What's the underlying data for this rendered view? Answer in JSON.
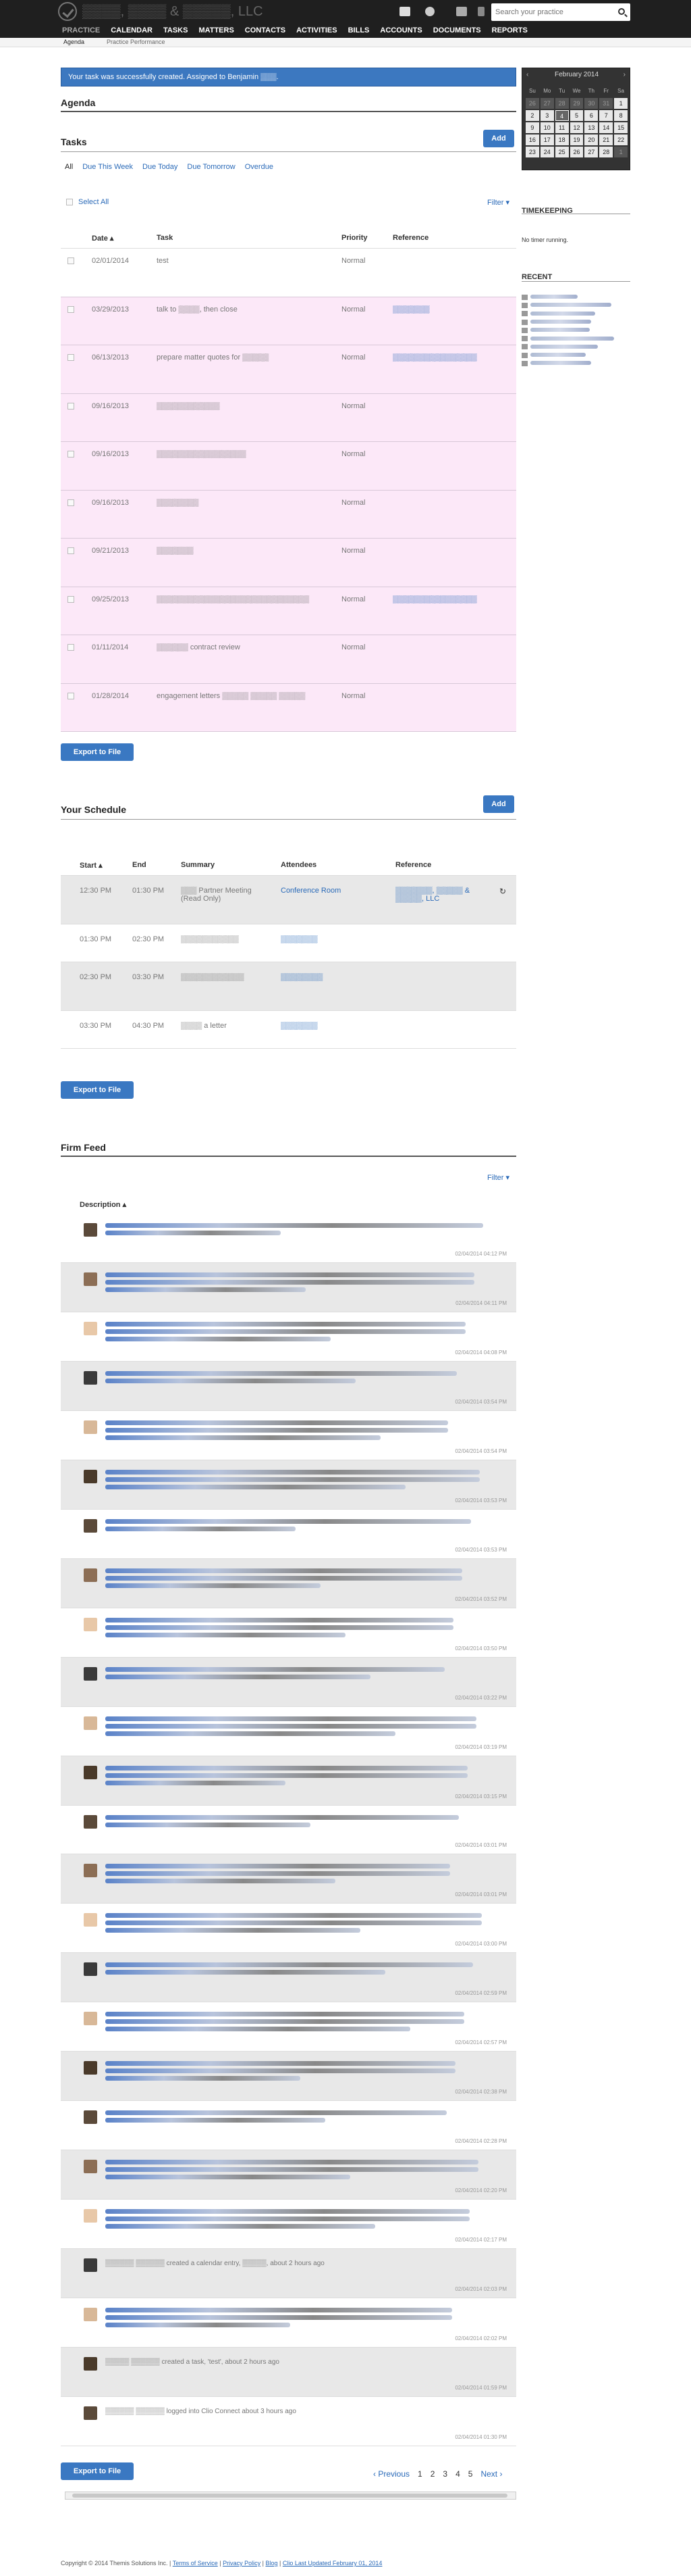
{
  "header": {
    "firm_name": "▒▒▒▒, ▒▒▒▒ & ▒▒▒▒▒, LLC",
    "search_placeholder": "Search your practice",
    "nav": [
      "PRACTICE",
      "CALENDAR",
      "TASKS",
      "MATTERS",
      "CONTACTS",
      "ACTIVITIES",
      "BILLS",
      "ACCOUNTS",
      "DOCUMENTS",
      "REPORTS"
    ],
    "subnav": [
      "Agenda",
      "Practice Performance"
    ]
  },
  "alert": {
    "message": "Your task was successfully created. Assigned to Benjamin ▒▒▒."
  },
  "agenda": {
    "title": "Agenda"
  },
  "tasks": {
    "title": "Tasks",
    "add_label": "Add",
    "tabs": [
      "All",
      "Due This Week",
      "Due Today",
      "Due Tomorrow",
      "Overdue"
    ],
    "select_all": "Select All",
    "filter": "Filter ▾",
    "columns": [
      "Date ▴",
      "Task",
      "Priority",
      "Reference"
    ],
    "rows": [
      {
        "date": "02/01/2014",
        "task": "test",
        "priority": "Normal",
        "ref": ""
      },
      {
        "date": "03/29/2013",
        "task": "talk to ▒▒▒▒, then close",
        "priority": "Normal",
        "ref": "▒▒▒▒▒▒▒"
      },
      {
        "date": "06/13/2013",
        "task": "prepare matter quotes for ▒▒▒▒▒",
        "priority": "Normal",
        "ref": "▒▒▒▒▒▒▒▒▒▒▒▒▒▒▒▒"
      },
      {
        "date": "09/16/2013",
        "task": "▒▒▒▒▒▒▒▒▒▒▒▒",
        "priority": "Normal",
        "ref": ""
      },
      {
        "date": "09/16/2013",
        "task": "▒▒▒▒▒▒▒▒▒▒▒▒▒▒▒▒▒",
        "priority": "Normal",
        "ref": ""
      },
      {
        "date": "09/16/2013",
        "task": "▒▒▒▒▒▒▒▒",
        "priority": "Normal",
        "ref": ""
      },
      {
        "date": "09/21/2013",
        "task": "▒▒▒▒▒▒▒",
        "priority": "Normal",
        "ref": ""
      },
      {
        "date": "09/25/2013",
        "task": "▒▒▒▒▒▒▒▒▒▒▒▒▒▒▒▒▒▒▒▒▒▒▒▒▒▒▒▒▒",
        "priority": "Normal",
        "ref": "▒▒▒▒▒▒▒▒▒▒▒▒▒▒▒▒"
      },
      {
        "date": "01/11/2014",
        "task": "▒▒▒▒▒▒ contract review",
        "priority": "Normal",
        "ref": ""
      },
      {
        "date": "01/28/2014",
        "task": "engagement letters ▒▒▒▒▒ ▒▒▒▒▒ ▒▒▒▒▒",
        "priority": "Normal",
        "ref": ""
      }
    ],
    "export_label": "Export to File"
  },
  "schedule": {
    "title": "Your Schedule",
    "add_label": "Add",
    "columns": [
      "Start ▴",
      "End",
      "Summary",
      "Attendees",
      "Reference"
    ],
    "rows": [
      {
        "start": "12:30 PM",
        "end": "01:30 PM",
        "summary": "▒▒▒ Partner Meeting (Read Only)",
        "attendees": "Conference Room",
        "ref": "▒▒▒▒▒▒▒, ▒▒▒▒▒ & ▒▒▒▒▒, LLC"
      },
      {
        "start": "01:30 PM",
        "end": "02:30 PM",
        "summary": "▒▒▒▒▒▒▒▒▒▒▒",
        "attendees": "▒▒▒▒▒▒▒",
        "ref": ""
      },
      {
        "start": "02:30 PM",
        "end": "03:30 PM",
        "summary": "▒▒▒▒▒▒▒▒▒▒▒▒",
        "attendees": "▒▒▒▒▒▒▒▒",
        "ref": ""
      },
      {
        "start": "03:30 PM",
        "end": "04:30 PM",
        "summary": "▒▒▒▒ a letter",
        "attendees": "▒▒▒▒▒▒▒",
        "ref": ""
      }
    ],
    "export_label": "Export to File"
  },
  "feed": {
    "title": "Firm Feed",
    "filter": "Filter ▾",
    "column": "Description ▴",
    "items": [
      {
        "time": "02/04/2014 04:12 PM",
        "text": ""
      },
      {
        "time": "02/04/2014 04:11 PM",
        "text": ""
      },
      {
        "time": "02/04/2014 04:08 PM",
        "text": ""
      },
      {
        "time": "02/04/2014 03:54 PM",
        "text": ""
      },
      {
        "time": "02/04/2014 03:54 PM",
        "text": ""
      },
      {
        "time": "02/04/2014 03:53 PM",
        "text": ""
      },
      {
        "time": "02/04/2014 03:53 PM",
        "text": ""
      },
      {
        "time": "02/04/2014 03:52 PM",
        "text": ""
      },
      {
        "time": "02/04/2014 03:50 PM",
        "text": ""
      },
      {
        "time": "02/04/2014 03:22 PM",
        "text": ""
      },
      {
        "time": "02/04/2014 03:19 PM",
        "text": ""
      },
      {
        "time": "02/04/2014 03:15 PM",
        "text": ""
      },
      {
        "time": "02/04/2014 03:01 PM",
        "text": ""
      },
      {
        "time": "02/04/2014 03:01 PM",
        "text": ""
      },
      {
        "time": "02/04/2014 03:00 PM",
        "text": ""
      },
      {
        "time": "02/04/2014 02:59 PM",
        "text": ""
      },
      {
        "time": "02/04/2014 02:57 PM",
        "text": ""
      },
      {
        "time": "02/04/2014 02:38 PM",
        "text": ""
      },
      {
        "time": "02/04/2014 02:28 PM",
        "text": ""
      },
      {
        "time": "02/04/2014 02:20 PM",
        "text": ""
      },
      {
        "time": "02/04/2014 02:17 PM",
        "text": ""
      },
      {
        "time": "02/04/2014 02:03 PM",
        "text": "▒▒▒▒▒▒ ▒▒▒▒▒▒ created a calendar entry, ▒▒▒▒▒, about 2 hours ago"
      },
      {
        "time": "02/04/2014 02:02 PM",
        "text": ""
      },
      {
        "time": "02/04/2014 01:59 PM",
        "text": "▒▒▒▒▒ ▒▒▒▒▒▒ created a task, 'test', about 2 hours ago"
      },
      {
        "time": "02/04/2014 01:30 PM",
        "text": "▒▒▒▒▒▒ ▒▒▒▒▒▒ logged into Clio Connect about 3 hours ago"
      }
    ],
    "export_label": "Export to File",
    "pager": {
      "prev": "‹ Previous",
      "pages": [
        "1",
        "2",
        "3",
        "4",
        "5"
      ],
      "next": "Next ›"
    }
  },
  "calendar": {
    "month": "February 2014",
    "days": [
      "Su",
      "Mo",
      "Tu",
      "We",
      "Th",
      "Fr",
      "Sa"
    ],
    "cells": [
      "26",
      "27",
      "28",
      "29",
      "30",
      "31",
      "1",
      "2",
      "3",
      "4",
      "5",
      "6",
      "7",
      "8",
      "9",
      "10",
      "11",
      "12",
      "13",
      "14",
      "15",
      "16",
      "17",
      "18",
      "19",
      "20",
      "21",
      "22",
      "23",
      "24",
      "25",
      "26",
      "27",
      "28",
      "1"
    ],
    "today": "4"
  },
  "timekeeping": {
    "title": "TIMEKEEPING",
    "status": "No timer running."
  },
  "recent": {
    "title": "RECENT"
  },
  "footer": {
    "copyright": "Copyright © 2014 Themis Solutions Inc. |",
    "links": [
      "Terms of Service",
      "Privacy Policy",
      "Blog",
      "Clio Last Updated February 01, 2014"
    ]
  }
}
